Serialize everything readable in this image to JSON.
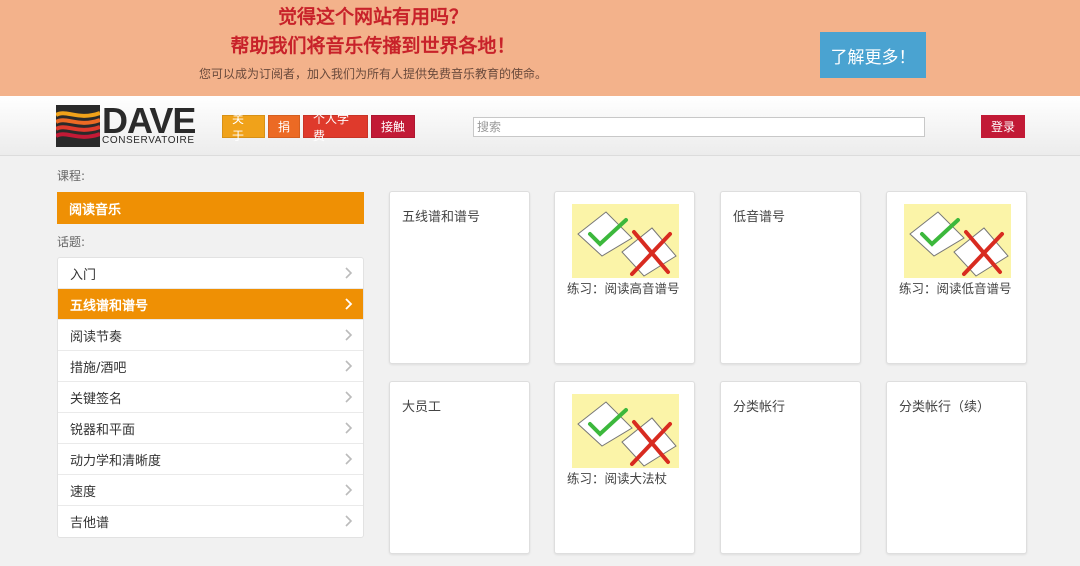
{
  "banner": {
    "title_line1": "觉得这个网站有用吗？",
    "title_line2": "帮助我们将音乐传播到世界各地！",
    "subtitle": "您可以成为订阅者，加入我们为所有人提供免费音乐教育的使命。",
    "button_label": "了解更多！",
    "background_color": "#f3b28b",
    "title_color": "#c8222a",
    "button_color": "#4aa3d1"
  },
  "header": {
    "logo_text": "DAVE",
    "logo_subtext": "CONSERVATOIRE",
    "nav": [
      "关于",
      "捐",
      "个人学费",
      "接触"
    ],
    "search_placeholder": "搜索",
    "login_label": "登录"
  },
  "sidebar": {
    "course_label": "课程:",
    "course_name": "阅读音乐",
    "topics_label": "话题:",
    "topics": [
      {
        "label": "入门"
      },
      {
        "label": "五线谱和谱号",
        "active": true
      },
      {
        "label": "阅读节奏"
      },
      {
        "label": "措施/酒吧"
      },
      {
        "label": "关键签名"
      },
      {
        "label": "锐器和平面"
      },
      {
        "label": "动力学和清晰度"
      },
      {
        "label": "速度"
      },
      {
        "label": "吉他谱"
      }
    ],
    "accent_color": "#ef9004"
  },
  "cards": [
    {
      "title": "五线谱和谱号",
      "type": "lesson"
    },
    {
      "caption": "练习：阅读高音谱号",
      "type": "exercise",
      "icon": "check-cross-exercise-icon"
    },
    {
      "title": "低音谱号",
      "type": "lesson"
    },
    {
      "caption": "练习：阅读低音谱号",
      "type": "exercise",
      "icon": "check-cross-exercise-icon"
    },
    {
      "title": "大员工",
      "type": "lesson"
    },
    {
      "caption": "练习：阅读大法杖",
      "type": "exercise",
      "icon": "check-cross-exercise-icon"
    },
    {
      "title": "分类帐行",
      "type": "lesson"
    },
    {
      "title": "分类帐行（续）",
      "type": "lesson"
    }
  ]
}
